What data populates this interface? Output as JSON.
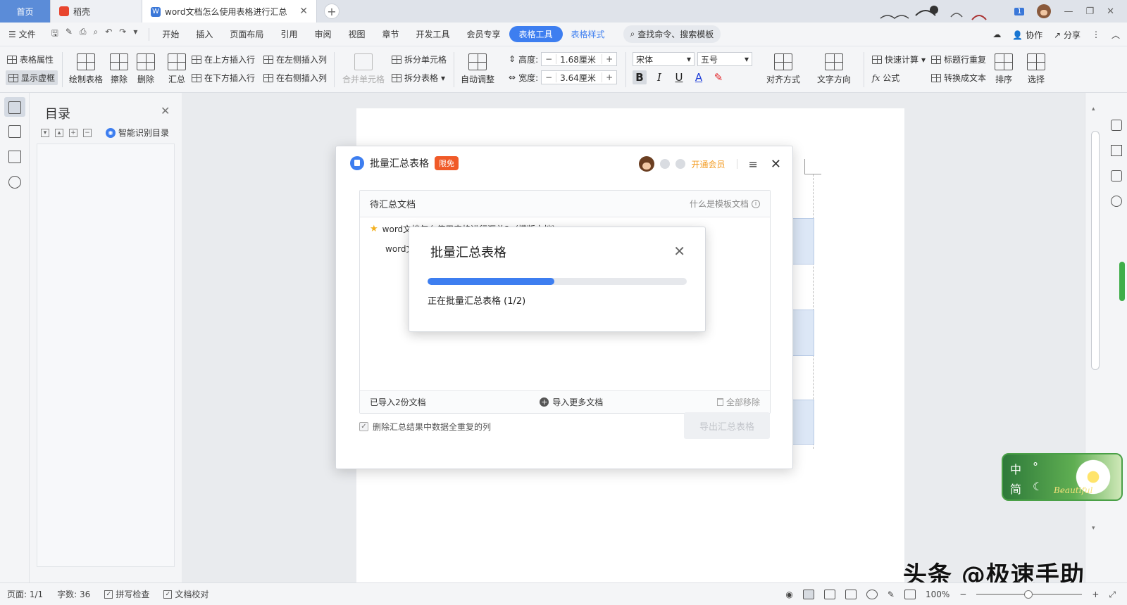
{
  "tabs": {
    "home": "首页",
    "daoke": "稻壳",
    "doc": "word文档怎么使用表格进行汇总",
    "badge": "1"
  },
  "menubar": {
    "file": "文件",
    "items": [
      "开始",
      "插入",
      "页面布局",
      "引用",
      "审阅",
      "视图",
      "章节",
      "开发工具",
      "会员专享"
    ],
    "active": "表格工具",
    "style": "表格样式",
    "search": "查找命令、搜索模板",
    "collab": "协作",
    "share": "分享"
  },
  "ribbon": {
    "table_props": "表格属性",
    "show_grid": "显示虚框",
    "draw_table": "绘制表格",
    "erase": "擦除",
    "delete": "删除",
    "summary": "汇总",
    "insert_above": "在上方插入行",
    "insert_below": "在下方插入行",
    "insert_left": "在左侧插入列",
    "insert_right": "在右侧插入列",
    "merge_cells": "合并单元格",
    "split_cells": "拆分单元格",
    "split_table": "拆分表格",
    "auto_adjust": "自动调整",
    "height_label": "高度:",
    "height_value": "1.68厘米",
    "width_label": "宽度:",
    "width_value": "3.64厘米",
    "font_name": "宋体",
    "font_size": "五号",
    "align": "对齐方式",
    "text_dir": "文字方向",
    "quick_calc": "快速计算",
    "title_repeat": "标题行重复",
    "formula": "公式",
    "to_text": "转换成文本",
    "sort": "排序",
    "select": "选择"
  },
  "toc": {
    "title": "目录",
    "smart": "智能识别目录"
  },
  "dialog": {
    "title": "批量汇总表格",
    "badge": "限免",
    "vip": "开通会员",
    "list_header": "待汇总文档",
    "help": "什么是模板文档",
    "row1": "word文档怎么使用表格进行汇总2（模版文档）",
    "row2": "word文",
    "imported": "已导入2份文档",
    "import_more": "导入更多文档",
    "remove_all": "全部移除",
    "checkbox_label": "删除汇总结果中数据全重复的列",
    "export": "导出汇总表格"
  },
  "progress": {
    "title": "批量汇总表格",
    "text": "正在批量汇总表格 (1/2)",
    "fraction": 0.49
  },
  "status": {
    "page": "页面: 1/1",
    "words": "字数: 36",
    "spell": "拼写检查",
    "proof": "文档校对",
    "zoom": "100%"
  },
  "ime": {
    "zh": "中",
    "simp": "简",
    "deco": "Beautiful"
  },
  "watermark": "头条 @极速手助"
}
